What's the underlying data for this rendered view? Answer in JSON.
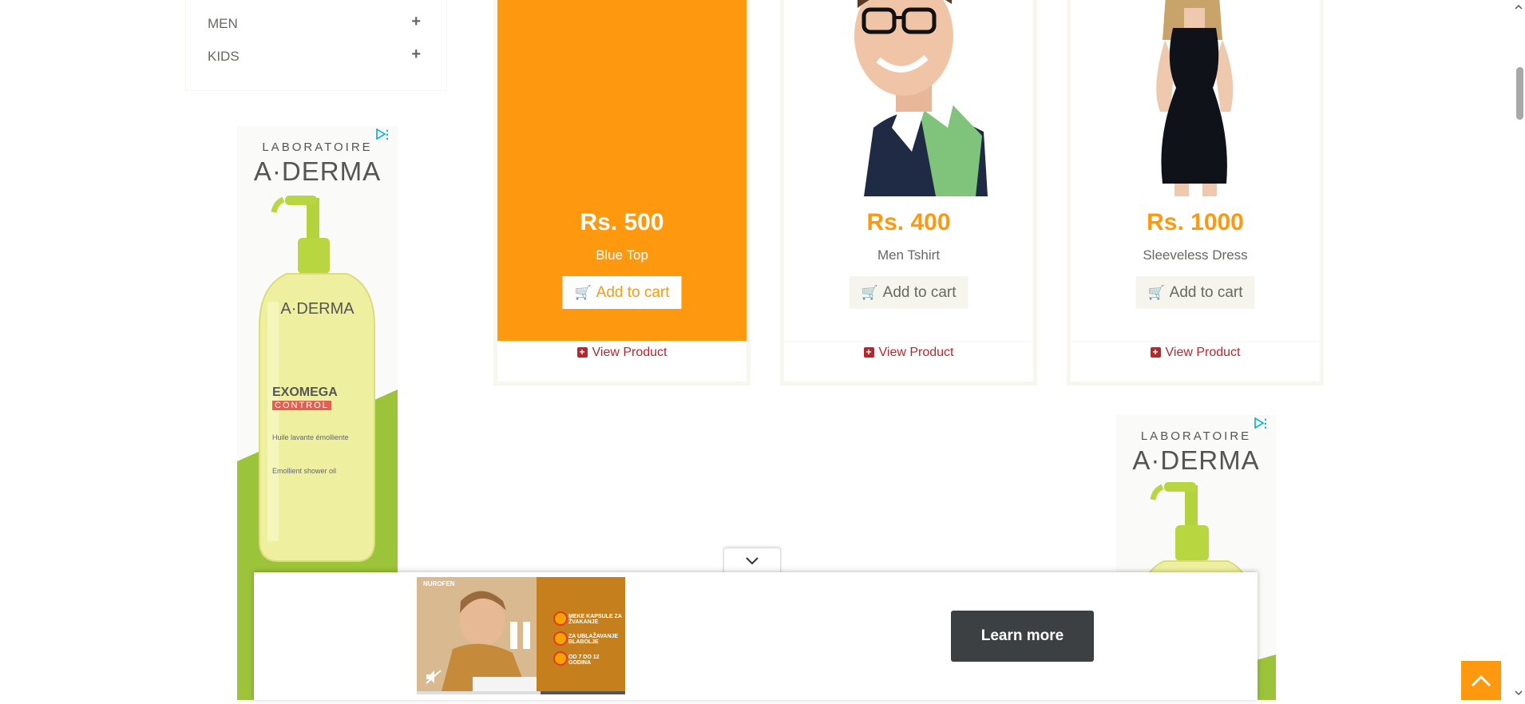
{
  "sidebar": {
    "categories": [
      {
        "label": "MEN",
        "toggle": "+"
      },
      {
        "label": "KIDS",
        "toggle": "+"
      }
    ]
  },
  "ads": {
    "brand_top": "LABORATOIRE",
    "brand": "A·DERMA",
    "bottle_brand": "A·DERMA",
    "bottle_name": "EXOMEGA",
    "bottle_sub": "CONTROL",
    "bottle_desc1": "Huile lavante émolliente",
    "bottle_desc2": "Emollient shower oil"
  },
  "products": [
    {
      "price": "Rs. 500",
      "name": "Blue Top",
      "cart_label": "Add to cart",
      "view_label": "View Product",
      "highlighted": true
    },
    {
      "price": "Rs. 400",
      "name": "Men Tshirt",
      "cart_label": "Add to cart",
      "view_label": "View Product",
      "highlighted": false
    },
    {
      "price": "Rs. 1000",
      "name": "Sleeveless Dress",
      "cart_label": "Add to cart",
      "view_label": "View Product",
      "highlighted": false
    }
  ],
  "video_ad": {
    "learn_more": "Learn more",
    "brand": "NUROFEN",
    "bullets": [
      "MEKE KAPSULE ZA ŽVAKANJE",
      "ZA UBLAŽAVANJE BLABOLJE",
      "OD 7 DO 12 GODINA"
    ]
  },
  "colors": {
    "accent": "#fe980f",
    "link": "#b3282d",
    "button_dark": "#3c4043"
  }
}
